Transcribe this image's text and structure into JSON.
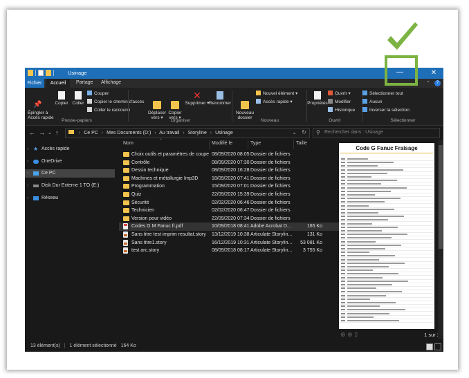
{
  "window": {
    "title": "Usinage"
  },
  "tabs": {
    "file": "Fichier",
    "home": "Accueil",
    "share": "Partage",
    "view": "Affichage"
  },
  "ribbon": {
    "clipboard": {
      "pin_quick": "Épingler à\nAccès rapide",
      "copy": "Copier",
      "paste": "Coller",
      "cut": "Couper",
      "copy_path": "Copier le chemin d'accès",
      "paste_shortcut": "Coller le raccourci",
      "label": "Presse-papiers"
    },
    "organize": {
      "move_to": "Déplacer\nvers ▾",
      "copy_to": "Copier\nvers ▾",
      "delete": "Supprimer ▾",
      "rename": "Renommer",
      "label": "Organiser"
    },
    "new": {
      "new_folder": "Nouveau\ndossier",
      "new_item": "Nouvel élément ▾",
      "easy_access": "Accès rapide ▾",
      "label": "Nouveau"
    },
    "open": {
      "properties": "Propriétés",
      "open": "Ouvrir ▾",
      "edit": "Modifier",
      "history": "Historique",
      "label": "Ouvrir"
    },
    "select": {
      "select_all": "Sélectionner tout",
      "select_none": "Aucun",
      "invert": "Inverser la sélection",
      "label": "Sélectionner"
    }
  },
  "address": {
    "crumbs": [
      "Ce PC",
      "Mes Documents (D:)",
      "Au travail",
      "Storyline",
      "Usinage"
    ],
    "search_placeholder": "Rechercher dans : Usinage"
  },
  "sidebar": {
    "items": [
      {
        "label": "Accès rapide",
        "icon": "star-icon"
      },
      {
        "label": "OneDrive",
        "icon": "cloud-icon"
      },
      {
        "label": "Ce PC",
        "icon": "computer-icon"
      },
      {
        "label": "Disk Dur Externe 1 TO (E:)",
        "icon": "drive-icon"
      },
      {
        "label": "Réseau",
        "icon": "network-icon"
      }
    ]
  },
  "columns": {
    "name": "Nom",
    "modified": "Modifié le",
    "type": "Type",
    "size": "Taille"
  },
  "files": [
    {
      "name": "Choix outils et paramètres de coupe",
      "modified": "08/09/2020 08:05",
      "type": "Dossier de fichiers",
      "size": "",
      "kind": "folder"
    },
    {
      "name": "Contrôle",
      "modified": "08/09/2020 07:30",
      "type": "Dossier de fichiers",
      "size": "",
      "kind": "folder"
    },
    {
      "name": "Dessin technique",
      "modified": "08/09/2020 16:28",
      "type": "Dossier de fichiers",
      "size": "",
      "kind": "folder"
    },
    {
      "name": "Machines et métallurgie Imp3D",
      "modified": "18/09/2020 07:41",
      "type": "Dossier de fichiers",
      "size": "",
      "kind": "folder"
    },
    {
      "name": "Programmation",
      "modified": "15/09/2020 07:01",
      "type": "Dossier de fichiers",
      "size": "",
      "kind": "folder"
    },
    {
      "name": "Quiz",
      "modified": "22/09/2020 15:39",
      "type": "Dossier de fichiers",
      "size": "",
      "kind": "folder"
    },
    {
      "name": "Sécurité",
      "modified": "02/02/2020 06:46",
      "type": "Dossier de fichiers",
      "size": "",
      "kind": "folder"
    },
    {
      "name": "Technicien",
      "modified": "02/02/2020 06:47",
      "type": "Dossier de fichiers",
      "size": "",
      "kind": "folder"
    },
    {
      "name": "Version pour vidéo",
      "modified": "22/09/2020 07:34",
      "type": "Dossier de fichiers",
      "size": "",
      "kind": "folder"
    },
    {
      "name": "Codes G M Fanuc fr.pdf",
      "modified": "10/09/2018 08:41",
      "type": "Adobe Acrobat D...",
      "size": "165 Ko",
      "kind": "pdf"
    },
    {
      "name": "Sans titre test imprim resultat.story",
      "modified": "13/12/2019 10:38",
      "type": "Articulate Storylin...",
      "size": "131 Ko",
      "kind": "story"
    },
    {
      "name": "Sans titre1.story",
      "modified": "16/12/2019 10:31",
      "type": "Articulate Storylin...",
      "size": "53 081 Ko",
      "kind": "story"
    },
    {
      "name": "test arc.story",
      "modified": "08/09/2018 08:17",
      "type": "Articulate Storylin...",
      "size": "3 755 Ko",
      "kind": "story"
    }
  ],
  "preview": {
    "title": "Code G Fanuc Fraisage",
    "page_indicator": "1 sur 2"
  },
  "status": {
    "count": "13 élément(s)",
    "selected": "1 élément sélectionné",
    "selected_size": "164 Ko"
  },
  "colors": {
    "titlebar": "#1e6fb8",
    "highlight": "#7cb342",
    "folder": "#f1c24c"
  }
}
